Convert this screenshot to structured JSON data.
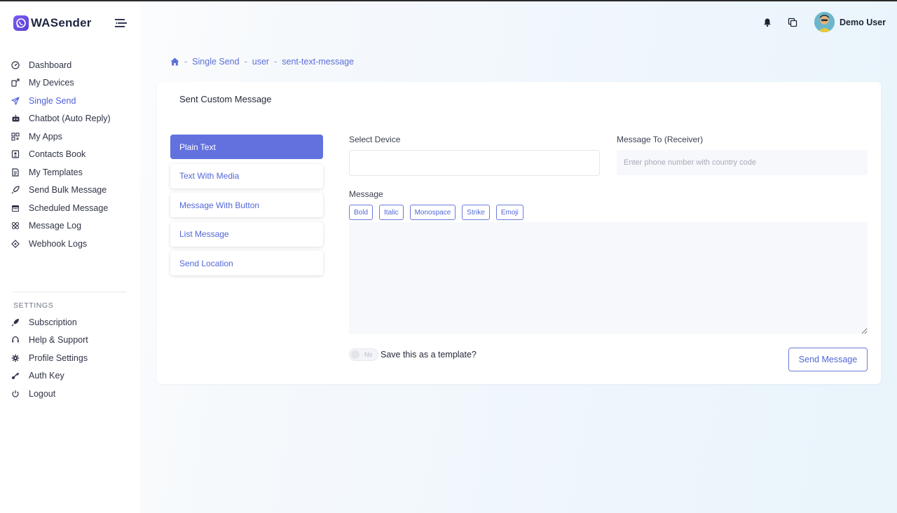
{
  "app": {
    "name": "WASender"
  },
  "header": {
    "user_name": "Demo User",
    "icons": [
      "bell-icon",
      "window-switch-icon"
    ]
  },
  "sidebar": {
    "items": [
      {
        "label": "Dashboard",
        "icon": "dashboard-icon",
        "active": false
      },
      {
        "label": "My Devices",
        "icon": "devices-icon",
        "active": false
      },
      {
        "label": "Single Send",
        "icon": "send-icon",
        "active": true
      },
      {
        "label": "Chatbot (Auto Reply)",
        "icon": "robot-icon",
        "active": false
      },
      {
        "label": "My Apps",
        "icon": "apps-icon",
        "active": false
      },
      {
        "label": "Contacts Book",
        "icon": "contacts-icon",
        "active": false
      },
      {
        "label": "My Templates",
        "icon": "templates-icon",
        "active": false
      },
      {
        "label": "Send Bulk Message",
        "icon": "rocket-icon",
        "active": false
      },
      {
        "label": "Scheduled Message",
        "icon": "calendar-icon",
        "active": false
      },
      {
        "label": "Message Log",
        "icon": "log-icon",
        "active": false
      },
      {
        "label": "Webhook Logs",
        "icon": "webhook-icon",
        "active": false
      }
    ],
    "settings_title": "SETTINGS",
    "settings_items": [
      {
        "label": "Subscription",
        "icon": "subscription-icon"
      },
      {
        "label": "Help & Support",
        "icon": "headset-icon"
      },
      {
        "label": "Profile Settings",
        "icon": "gear-icon"
      },
      {
        "label": "Auth Key",
        "icon": "key-icon"
      },
      {
        "label": "Logout",
        "icon": "power-icon"
      }
    ]
  },
  "breadcrumb": {
    "items": [
      "Single Send",
      "user",
      "sent-text-message"
    ],
    "separator": "-"
  },
  "card": {
    "title": "Sent Custom Message",
    "tabs": [
      {
        "label": "Plain Text",
        "active": true
      },
      {
        "label": "Text With Media",
        "active": false
      },
      {
        "label": "Message With Button",
        "active": false
      },
      {
        "label": "List Message",
        "active": false
      },
      {
        "label": "Send Location",
        "active": false
      }
    ],
    "form": {
      "select_device_label": "Select Device",
      "receiver_label": "Message To (Receiver)",
      "receiver_placeholder": "Enter phone number with country code",
      "message_label": "Message",
      "format_buttons": [
        "Bold",
        "Italic",
        "Monospace",
        "Strike",
        "Emoji"
      ],
      "toggle_text": "No",
      "save_template_label": "Save this as a template?",
      "send_button": "Send Message"
    }
  },
  "colors": {
    "accent": "#6371de",
    "link": "#5367d6",
    "brand": "#6a4be6"
  }
}
